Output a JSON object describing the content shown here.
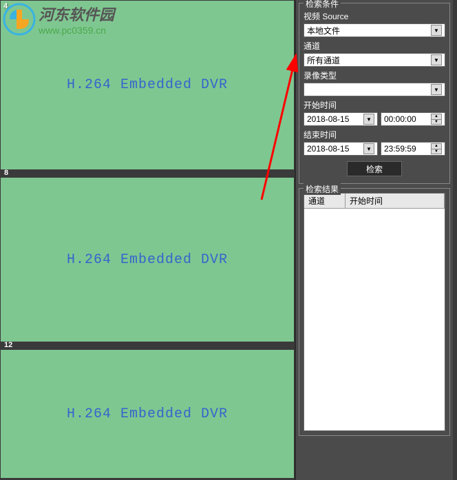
{
  "watermark": {
    "brand": "河东软件园",
    "url": "www.pc0359.cn"
  },
  "tiles": [
    {
      "num": "4",
      "text": "H.264 Embedded DVR"
    },
    {
      "num": "8",
      "text": "H.264 Embedded DVR"
    },
    {
      "num": "12",
      "text": "H.264 Embedded DVR"
    }
  ],
  "search": {
    "legend": "检索条件",
    "sourceLabel": "视频 Source",
    "sourceValue": "本地文件",
    "channelLabel": "通道",
    "channelValue": "所有通道",
    "recordTypeLabel": "录像类型",
    "recordTypeValue": "",
    "startTimeLabel": "开始时间",
    "startDate": "2018-08-15",
    "startTime": "00:00:00",
    "endTimeLabel": "结束时间",
    "endDate": "2018-08-15",
    "endTime": "23:59:59",
    "searchBtn": "检索"
  },
  "results": {
    "legend": "检索结果",
    "col1": "通道",
    "col2": "开始时间"
  }
}
